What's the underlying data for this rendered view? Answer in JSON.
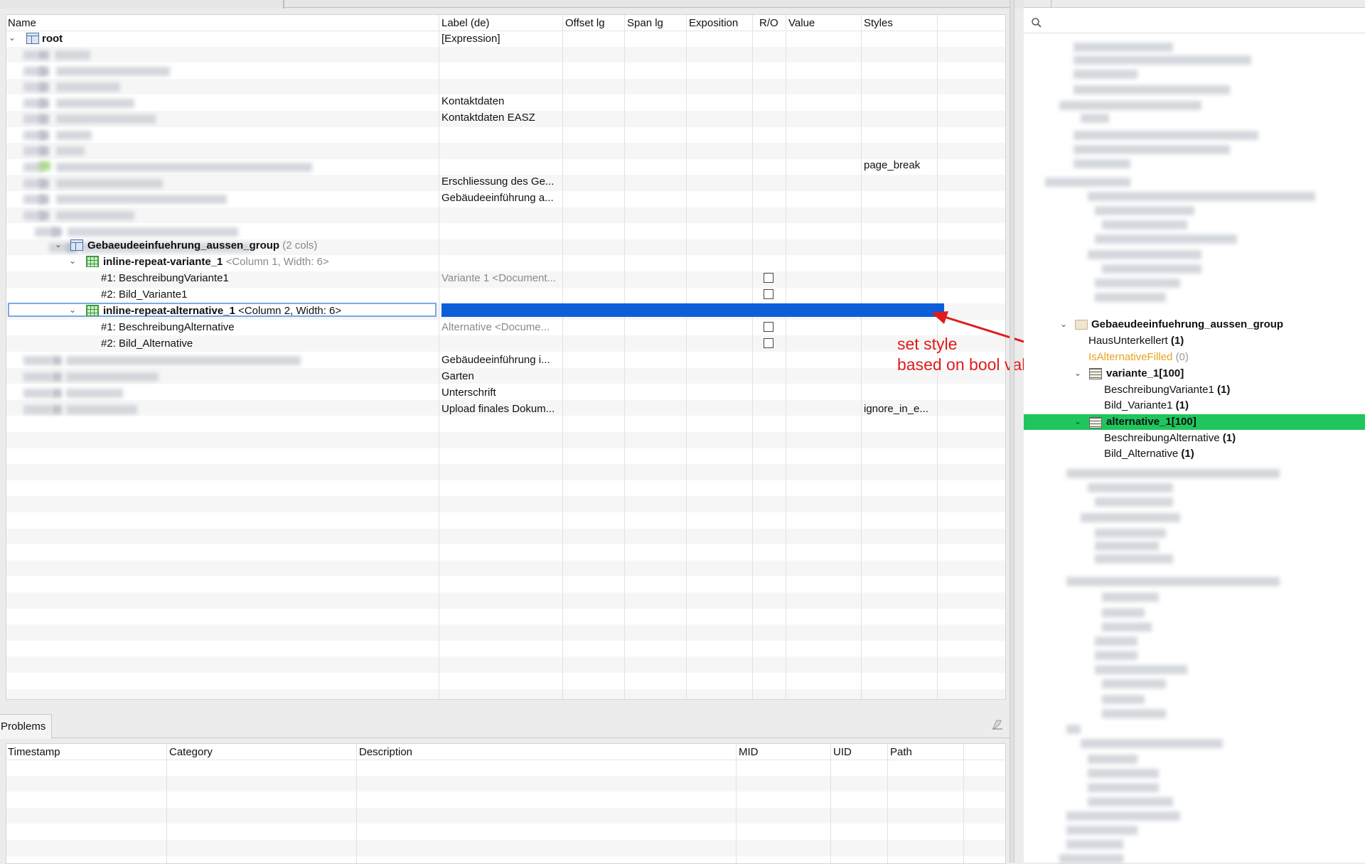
{
  "main_table": {
    "columns": [
      "Name",
      "Label (de)",
      "Offset lg",
      "Span lg",
      "Exposition",
      "R/O",
      "Value",
      "Styles"
    ],
    "rows": [
      {
        "name": "root",
        "label": "[Expression]"
      },
      {
        "label": "Kontaktdaten"
      },
      {
        "label": "Kontaktdaten EASZ"
      },
      {
        "styles": "page_break"
      },
      {
        "label": "Erschliessung des Ge..."
      },
      {
        "label": "Gebäudeeinführung a..."
      },
      {
        "name": "Gebaeudeeinfuehrung_aussen_group",
        "detail": "(2 cols)"
      },
      {
        "name": "inline-repeat-variante_1",
        "detail": "<Column 1, Width: 6>"
      },
      {
        "name": "#1: BeschreibungVariante1",
        "label": "Variante 1 <Document..."
      },
      {
        "name": "#2: Bild_Variante1"
      },
      {
        "name": "inline-repeat-alternative_1",
        "detail": "<Column 2, Width: 6>"
      },
      {
        "name": "#1: BeschreibungAlternative",
        "label": "Alternative <Docume..."
      },
      {
        "name": "#2: Bild_Alternative"
      },
      {
        "label": "Gebäudeeinführung i..."
      },
      {
        "label": "Garten"
      },
      {
        "label": "Unterschrift"
      },
      {
        "label": "Upload finales Dokum...",
        "styles": "ignore_in_e..."
      }
    ]
  },
  "problems": {
    "tab_label": "Problems",
    "columns": [
      "Timestamp",
      "Category",
      "Description",
      "MID",
      "UID",
      "Path"
    ]
  },
  "right_tree": {
    "search_placeholder": "",
    "items": [
      {
        "name": "Gebaeudeeinfuehrung_aussen_group"
      },
      {
        "name": "HausUnterkellert",
        "count": "(1)"
      },
      {
        "name": "IsAlternativeFilled",
        "count": "(0)"
      },
      {
        "name": "variante_1[100]"
      },
      {
        "name": "BeschreibungVariante1",
        "count": "(1)"
      },
      {
        "name": "Bild_Variante1",
        "count": "(1)"
      },
      {
        "name": "alternative_1[100]"
      },
      {
        "name": "BeschreibungAlternative",
        "count": "(1)"
      },
      {
        "name": "Bild_Alternative",
        "count": "(1)"
      }
    ]
  },
  "annotation": {
    "line1": "set style",
    "line2": "based on bool value",
    "color": "#e01b1b"
  },
  "colors": {
    "selection_blue": "#0b5ed7",
    "selection_green": "#1fc65d",
    "warning_orange": "#e8a21a"
  }
}
